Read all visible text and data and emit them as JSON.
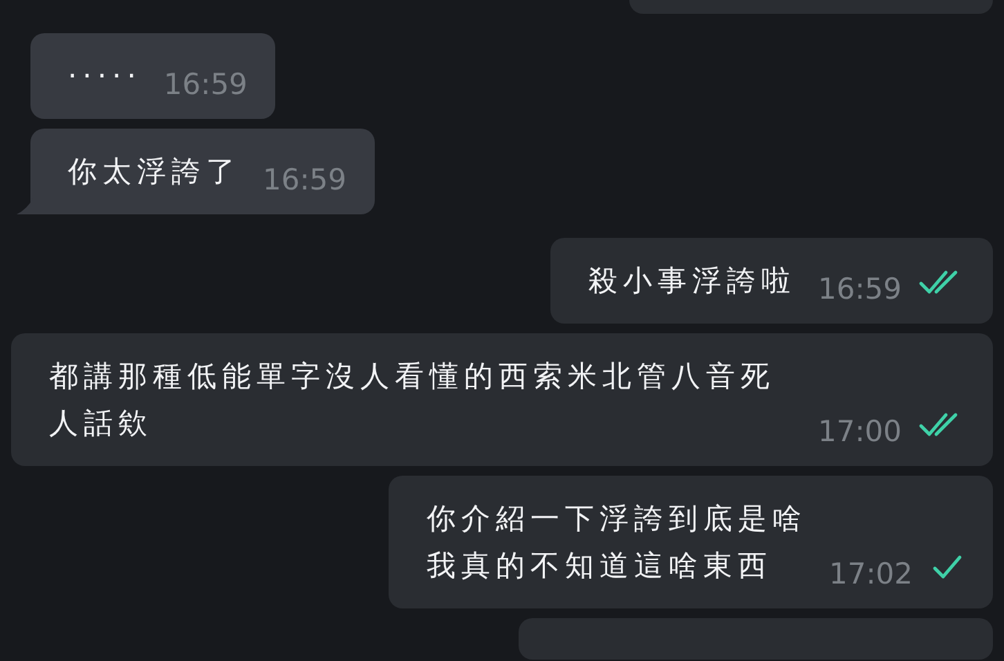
{
  "messages": [
    {
      "outgoing": false,
      "lines": [
        "·····"
      ],
      "time": "16:59",
      "tail": false
    },
    {
      "outgoing": false,
      "lines": [
        "你太浮誇了"
      ],
      "time": "16:59",
      "tail": true
    },
    {
      "outgoing": true,
      "lines": [
        "殺小事浮誇啦"
      ],
      "time": "16:59",
      "read": true
    },
    {
      "outgoing": true,
      "lines": [
        "都講那種低能單字沒人看懂的西索米北管八音死人話欸"
      ],
      "time": "17:00",
      "read": true
    },
    {
      "outgoing": true,
      "lines": [
        "你介紹一下浮誇到底是啥",
        "我真的不知道這啥東西"
      ],
      "time": "17:02",
      "read": false
    }
  ]
}
